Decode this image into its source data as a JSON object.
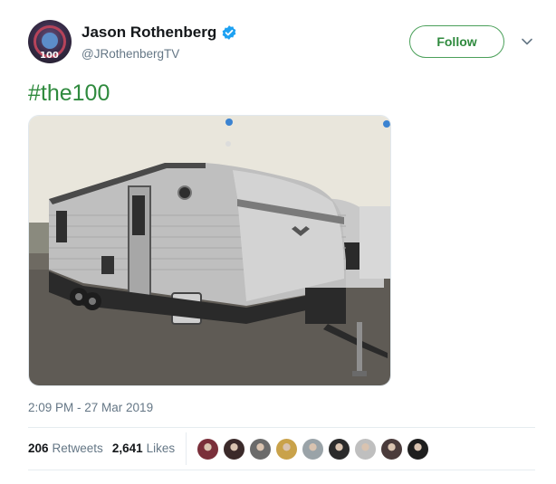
{
  "author": {
    "display_name": "Jason Rothenberg",
    "handle": "@JRothenbergTV",
    "verified": true,
    "avatar_icon": "the100-logo-avatar",
    "avatar_text": "100"
  },
  "follow_label": "Follow",
  "menu_icon": "chevron-down-icon",
  "tweet_text": "#the100",
  "media": {
    "description_icon": "photo",
    "alt": ""
  },
  "timestamp": "2:09 PM - 27 Mar 2019",
  "stats": {
    "retweets_count": "206",
    "retweets_label": "Retweets",
    "likes_count": "2,641",
    "likes_label": "Likes"
  },
  "liker_avatars": [
    "#7a2f3a",
    "#3b2a2a",
    "#6b6b6b",
    "#c9a24a",
    "#9aa3a8",
    "#2b2b2b",
    "#bfbfbf",
    "#4a3b3b",
    "#1e1e1e"
  ],
  "colors": {
    "accent_green": "#2f8a3e",
    "verified_blue": "#1da1f2",
    "muted": "#657786"
  }
}
